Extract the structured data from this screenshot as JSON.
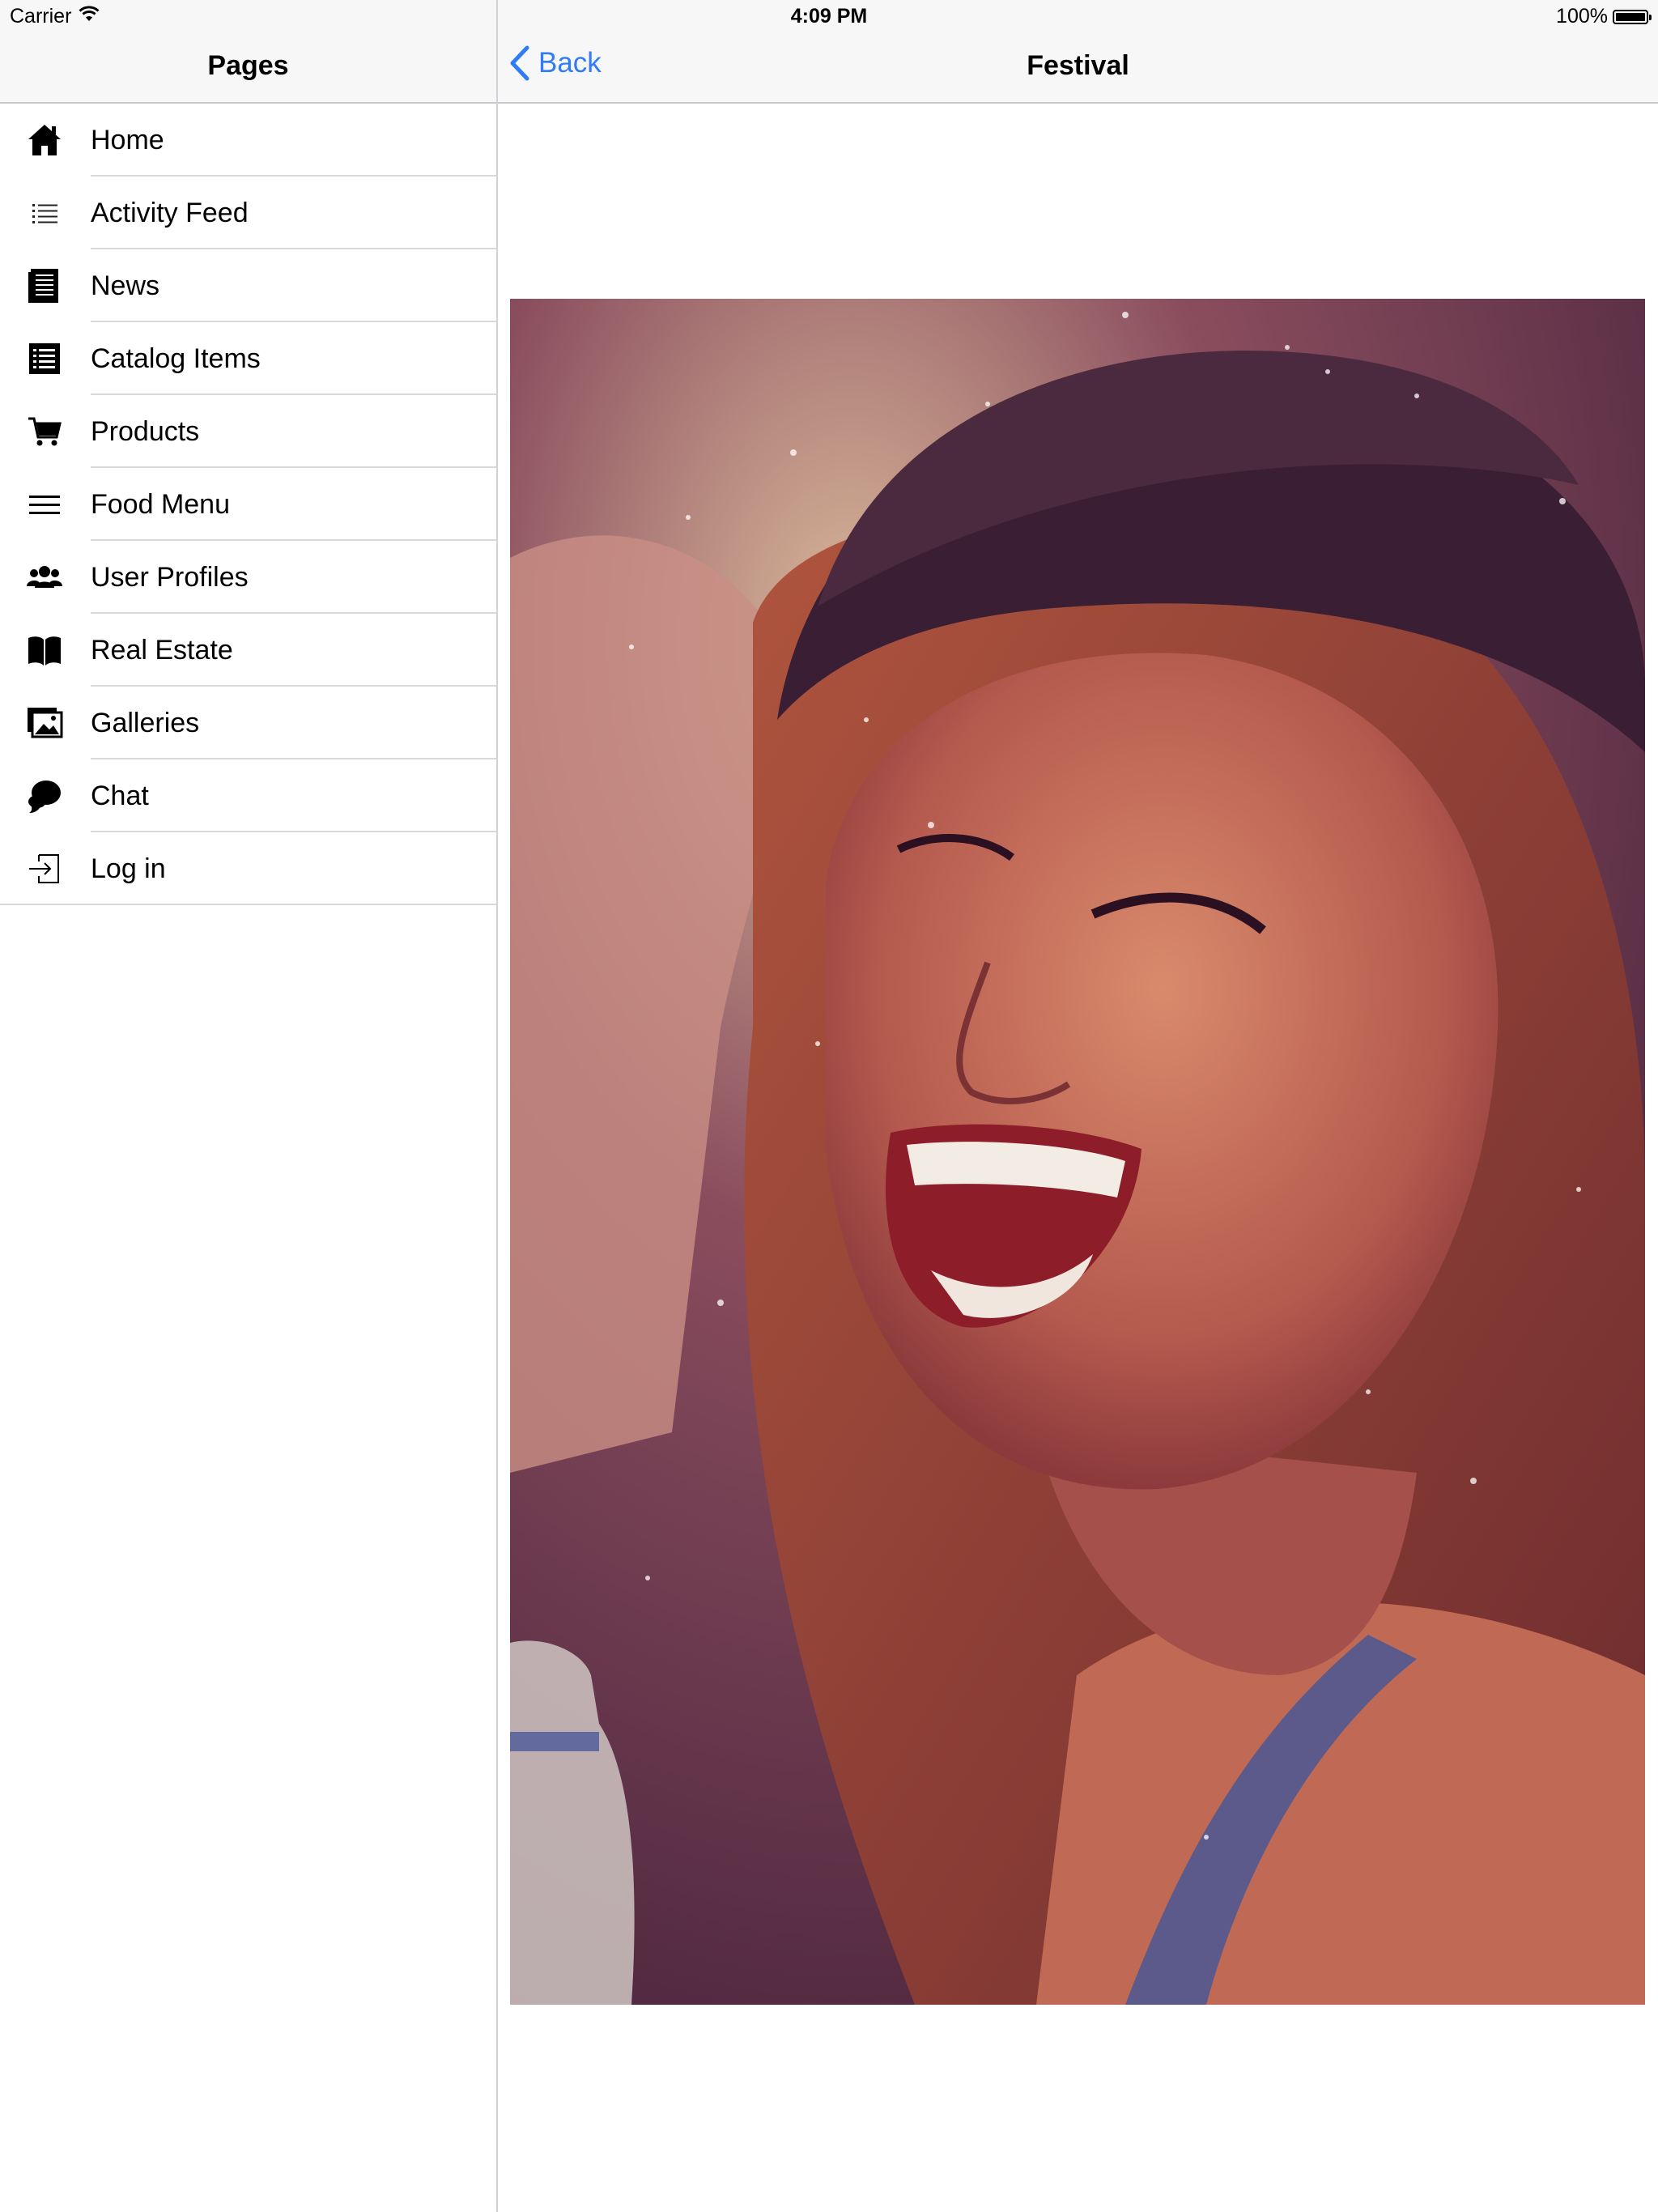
{
  "status_bar": {
    "carrier": "Carrier",
    "time": "4:09 PM",
    "battery_text": "100%",
    "battery_level": 1.0
  },
  "sidebar": {
    "title": "Pages",
    "items": [
      {
        "label": "Home",
        "icon": "home-icon"
      },
      {
        "label": "Activity Feed",
        "icon": "list-icon"
      },
      {
        "label": "News",
        "icon": "newspaper-icon"
      },
      {
        "label": "Catalog Items",
        "icon": "catalog-icon"
      },
      {
        "label": "Products",
        "icon": "cart-icon"
      },
      {
        "label": "Food Menu",
        "icon": "menu-lines-icon"
      },
      {
        "label": "User Profiles",
        "icon": "users-icon"
      },
      {
        "label": "Real Estate",
        "icon": "book-icon"
      },
      {
        "label": "Galleries",
        "icon": "gallery-icon"
      },
      {
        "label": "Chat",
        "icon": "chat-icon"
      },
      {
        "label": "Log in",
        "icon": "login-icon"
      }
    ]
  },
  "detail": {
    "back_label": "Back",
    "title": "Festival",
    "image": "festival-photo"
  },
  "colors": {
    "accent": "#2f7cf6",
    "bar_background": "#f7f7f7",
    "separator": "#d9d9dd"
  }
}
